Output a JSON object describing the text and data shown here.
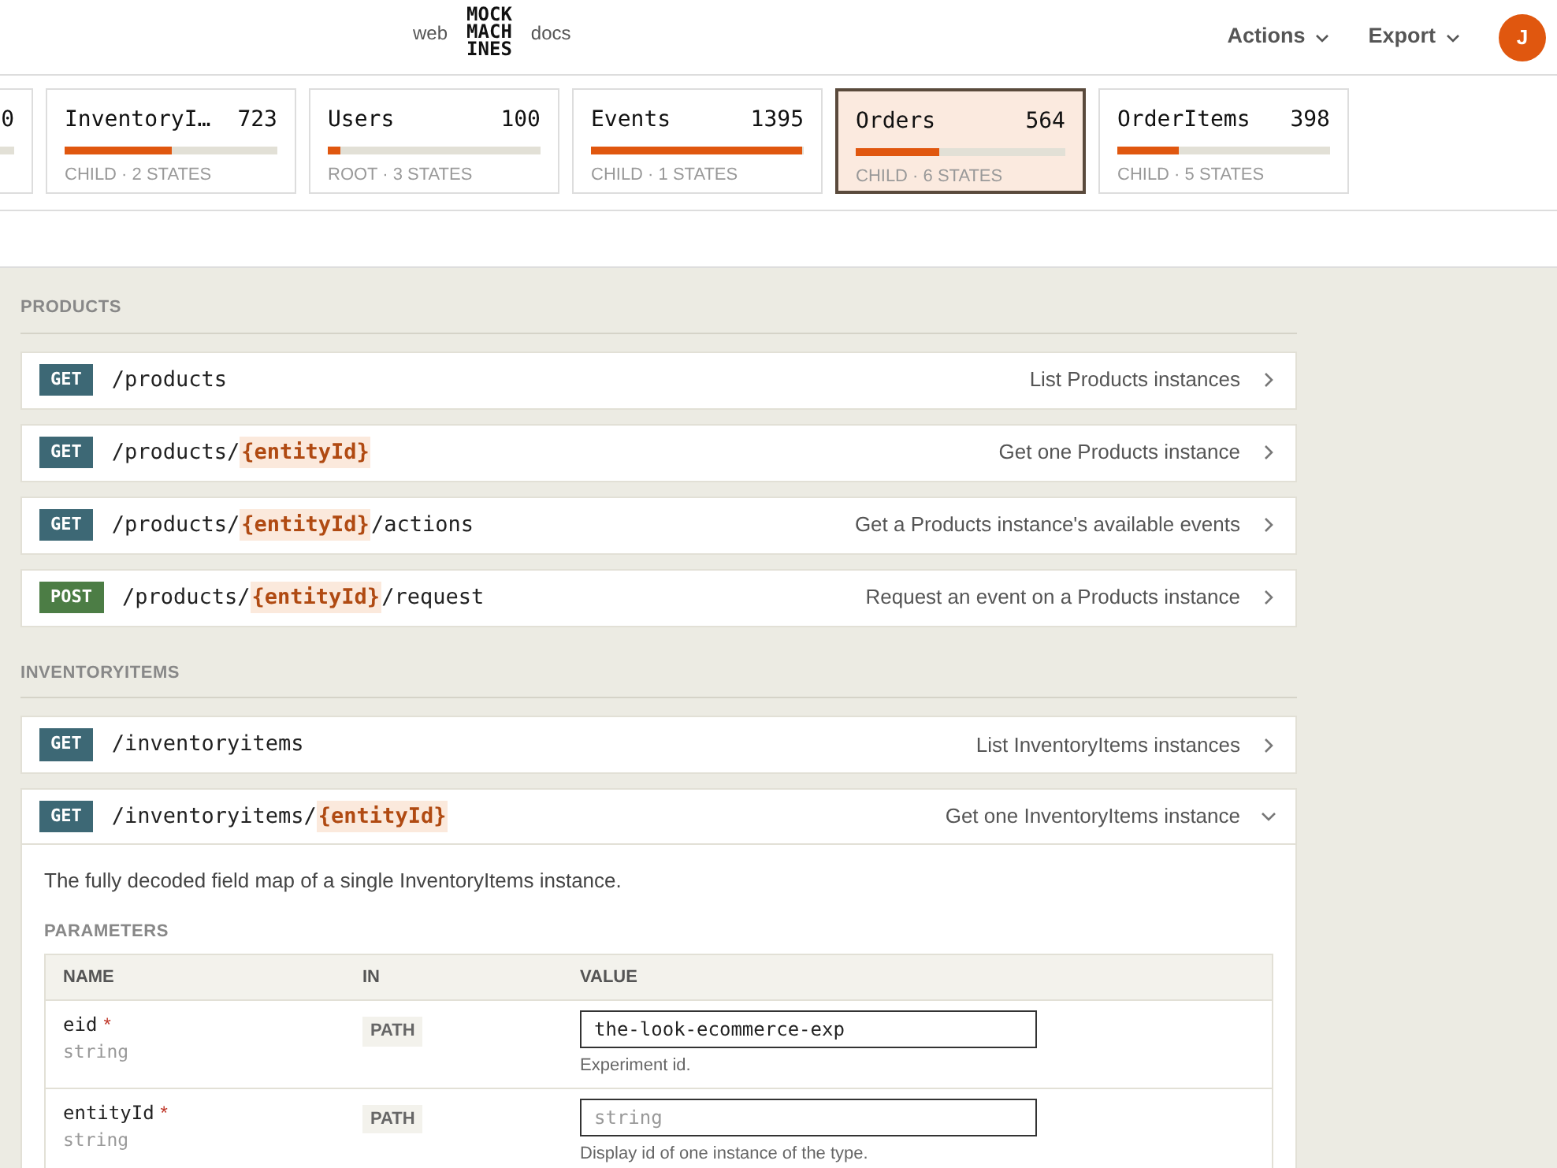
{
  "header": {
    "nav_left": "web",
    "logo": [
      "MOCK",
      "MACH",
      "INES"
    ],
    "nav_right": "docs",
    "menus": [
      {
        "label": "Actions"
      },
      {
        "label": "Export"
      }
    ],
    "avatar": "J"
  },
  "entity_cards": [
    {
      "count": "0",
      "selected": false
    },
    {
      "name": "InventoryI…",
      "count": "723",
      "level": 0.5,
      "meta": "CHILD · 2 STATES",
      "selected": false
    },
    {
      "name": "Users",
      "count": "100",
      "level": 0.06,
      "meta": "ROOT · 3 STATES",
      "selected": false
    },
    {
      "name": "Events",
      "count": "1395",
      "level": 0.99,
      "meta": "CHILD · 1 STATES",
      "selected": false
    },
    {
      "name": "Orders",
      "count": "564",
      "level": 0.4,
      "meta": "CHILD · 6 STATES",
      "selected": true
    },
    {
      "name": "OrderItems",
      "count": "398",
      "level": 0.29,
      "meta": "CHILD · 5 STATES",
      "selected": false
    }
  ],
  "sections": [
    {
      "title": "PRODUCTS",
      "endpoints": [
        {
          "method": "GET",
          "path": [
            {
              "kind": "literal",
              "text": "/products"
            }
          ],
          "summary": "List Products instances",
          "expanded": false
        },
        {
          "method": "GET",
          "path": [
            {
              "kind": "literal",
              "text": "/products/"
            },
            {
              "kind": "param",
              "text": "{entityId}"
            }
          ],
          "summary": "Get one Products instance",
          "expanded": false
        },
        {
          "method": "GET",
          "path": [
            {
              "kind": "literal",
              "text": "/products/"
            },
            {
              "kind": "param",
              "text": "{entityId}"
            },
            {
              "kind": "literal",
              "text": "/actions"
            }
          ],
          "summary": "Get a Products instance's available events",
          "expanded": false
        },
        {
          "method": "POST",
          "path": [
            {
              "kind": "literal",
              "text": "/products/"
            },
            {
              "kind": "param",
              "text": "{entityId}"
            },
            {
              "kind": "literal",
              "text": "/request"
            }
          ],
          "summary": "Request an event on a Products instance",
          "expanded": false
        }
      ]
    },
    {
      "title": "INVENTORYITEMS",
      "endpoints": [
        {
          "method": "GET",
          "path": [
            {
              "kind": "literal",
              "text": "/inventoryitems"
            }
          ],
          "summary": "List InventoryItems instances",
          "expanded": false
        },
        {
          "method": "GET",
          "path": [
            {
              "kind": "literal",
              "text": "/inventoryitems/"
            },
            {
              "kind": "param",
              "text": "{entityId}"
            }
          ],
          "summary": "Get one InventoryItems instance",
          "expanded": true,
          "description": "The fully decoded field map of a single InventoryItems instance.",
          "parameters_title": "PARAMETERS",
          "columns": [
            "NAME",
            "IN",
            "VALUE"
          ],
          "parameters": [
            {
              "name": "eid",
              "required_mark": "*",
              "type": "string",
              "in": "PATH",
              "value": "the-look-ecommerce-exp",
              "help": "Experiment id."
            },
            {
              "name": "entityId",
              "required_mark": "*",
              "type": "string",
              "in": "PATH",
              "placeholder": "string",
              "help": "Display id of one instance of the type."
            }
          ]
        }
      ]
    }
  ]
}
